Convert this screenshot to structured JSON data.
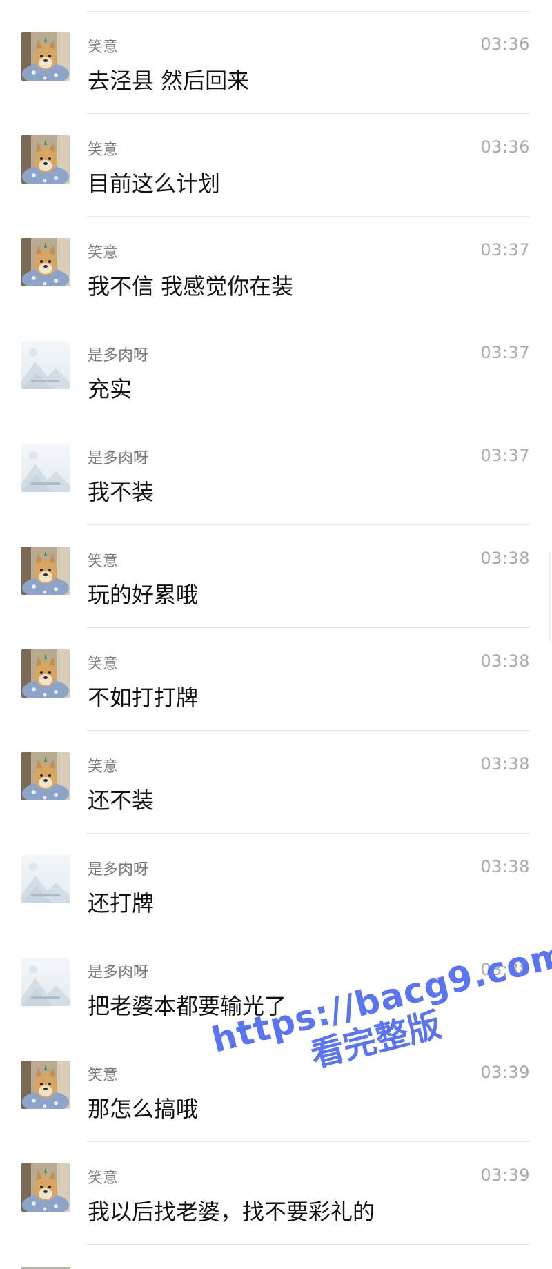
{
  "messages": [
    {
      "sender": "笑意",
      "time": "03:36",
      "text": "去泾县 然后回来",
      "avatar": "dog-avatar"
    },
    {
      "sender": "笑意",
      "time": "03:36",
      "text": "目前这么计划",
      "avatar": "dog-avatar"
    },
    {
      "sender": "笑意",
      "time": "03:37",
      "text": "我不信 我感觉你在装",
      "avatar": "dog-avatar"
    },
    {
      "sender": "是多肉呀",
      "time": "03:37",
      "text": "充实",
      "avatar": "placeholder-avatar"
    },
    {
      "sender": "是多肉呀",
      "time": "03:37",
      "text": "我不装",
      "avatar": "placeholder-avatar"
    },
    {
      "sender": "笑意",
      "time": "03:38",
      "text": "玩的好累哦",
      "avatar": "dog-avatar"
    },
    {
      "sender": "笑意",
      "time": "03:38",
      "text": "不如打打牌",
      "avatar": "dog-avatar"
    },
    {
      "sender": "笑意",
      "time": "03:38",
      "text": "还不装",
      "avatar": "dog-avatar"
    },
    {
      "sender": "是多肉呀",
      "time": "03:38",
      "text": "还打牌",
      "avatar": "placeholder-avatar"
    },
    {
      "sender": "是多肉呀",
      "time": "03:38",
      "text": "把老婆本都要输光了",
      "avatar": "placeholder-avatar"
    },
    {
      "sender": "笑意",
      "time": "03:39",
      "text": "那怎么搞哦",
      "avatar": "dog-avatar"
    },
    {
      "sender": "笑意",
      "time": "03:39",
      "text": "我以后找老婆，找不要彩礼的",
      "avatar": "dog-avatar"
    }
  ],
  "watermark": {
    "url": "https://bacg9.com",
    "text": "看完整版"
  },
  "colors": {
    "watermark": "#5b74f0",
    "divider": "#e7e7e7",
    "name": "#7a7a7a",
    "time": "#a9a9a9"
  }
}
